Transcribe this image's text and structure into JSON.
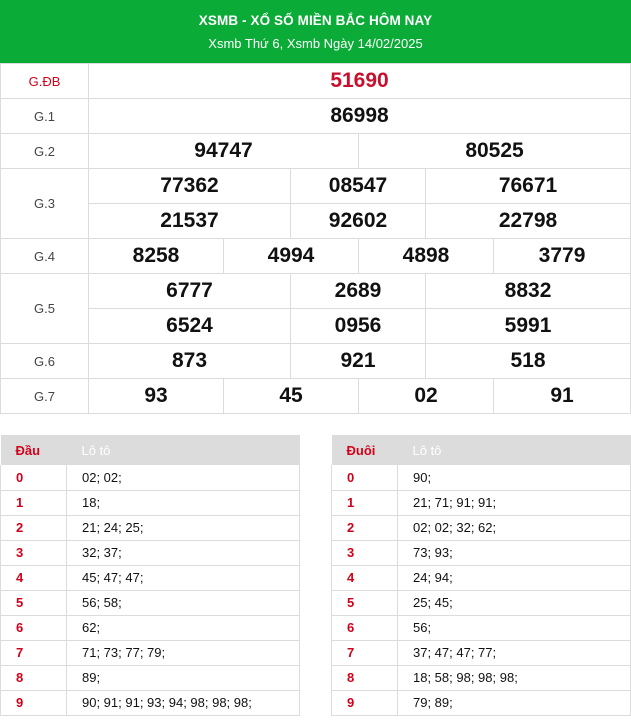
{
  "header": {
    "title": "XSMB - XỔ SỐ MIỀN BẮC HÔM NAY",
    "subtitle": "Xsmb Thứ 6, Xsmb Ngày 14/02/2025"
  },
  "prizes": {
    "gdb": {
      "label": "G.ĐB",
      "numbers": [
        "51690"
      ]
    },
    "g1": {
      "label": "G.1",
      "numbers": [
        "86998"
      ]
    },
    "g2": {
      "label": "G.2",
      "numbers": [
        "94747",
        "80525"
      ]
    },
    "g3": {
      "label": "G.3",
      "numbers": [
        "77362",
        "08547",
        "76671",
        "21537",
        "92602",
        "22798"
      ]
    },
    "g4": {
      "label": "G.4",
      "numbers": [
        "8258",
        "4994",
        "4898",
        "3779"
      ]
    },
    "g5": {
      "label": "G.5",
      "numbers": [
        "6777",
        "2689",
        "8832",
        "6524",
        "0956",
        "5991"
      ]
    },
    "g6": {
      "label": "G.6",
      "numbers": [
        "873",
        "921",
        "518"
      ]
    },
    "g7": {
      "label": "G.7",
      "numbers": [
        "93",
        "45",
        "02",
        "91"
      ]
    }
  },
  "loto_dau": {
    "col1": "Đầu",
    "col2": "Lô tô",
    "rows": [
      {
        "key": "0",
        "value": "02; 02;"
      },
      {
        "key": "1",
        "value": "18;"
      },
      {
        "key": "2",
        "value": "21; 24; 25;"
      },
      {
        "key": "3",
        "value": "32; 37;"
      },
      {
        "key": "4",
        "value": "45; 47; 47;"
      },
      {
        "key": "5",
        "value": "56; 58;"
      },
      {
        "key": "6",
        "value": "62;"
      },
      {
        "key": "7",
        "value": "71; 73; 77; 79;"
      },
      {
        "key": "8",
        "value": "89;"
      },
      {
        "key": "9",
        "value": "90; 91; 91; 93; 94; 98; 98; 98;"
      }
    ]
  },
  "loto_duoi": {
    "col1": "Đuôi",
    "col2": "Lô tô",
    "rows": [
      {
        "key": "0",
        "value": "90;"
      },
      {
        "key": "1",
        "value": "21; 71; 91; 91;"
      },
      {
        "key": "2",
        "value": "02; 02; 32; 62;"
      },
      {
        "key": "3",
        "value": "73; 93;"
      },
      {
        "key": "4",
        "value": "24; 94;"
      },
      {
        "key": "5",
        "value": "25; 45;"
      },
      {
        "key": "6",
        "value": "56;"
      },
      {
        "key": "7",
        "value": "37; 47; 47; 77;"
      },
      {
        "key": "8",
        "value": "18; 58; 98; 98; 98;"
      },
      {
        "key": "9",
        "value": "79; 89;"
      }
    ]
  },
  "colors": {
    "header_bg": "#0aab37",
    "special_prize": "#c8102e",
    "key_red": "#d0021b",
    "table_header_bg": "#dcdcdc"
  }
}
